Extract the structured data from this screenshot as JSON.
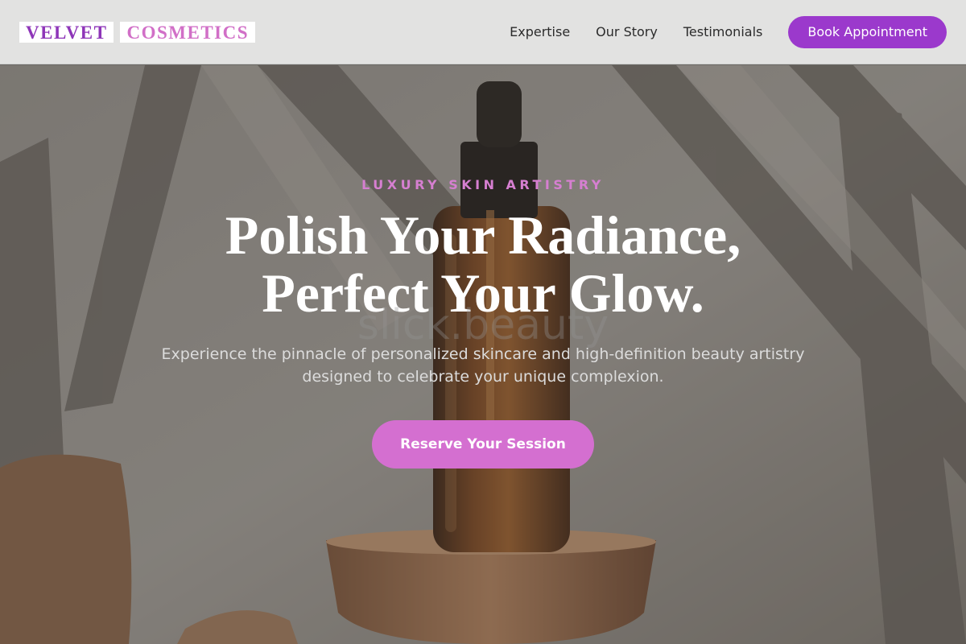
{
  "brand": {
    "word1": "VELVET",
    "word2": "COSMETICS",
    "colors": {
      "purple": "#8e35b8",
      "pink": "#d16fc7"
    }
  },
  "nav": {
    "items": [
      {
        "label": "Expertise"
      },
      {
        "label": "Our Story"
      },
      {
        "label": "Testimonials"
      }
    ],
    "cta_label": "Book Appointment",
    "cta_color": "#9b39cc"
  },
  "hero": {
    "eyebrow": "LUXURY SKIN ARTISTRY",
    "headline_line1": "Polish Your Radiance,",
    "headline_line2": "Perfect Your Glow.",
    "watermark": "slick.beauty",
    "subtext": "Experience the pinnacle of personalized skincare and high-definition beauty artistry designed to celebrate your unique complexion.",
    "cta_label": "Reserve Your Session",
    "cta_color": "#d46fd0",
    "background_image": "amber dropper serum bottle on wooden pedestal with palm leaf shadows"
  }
}
